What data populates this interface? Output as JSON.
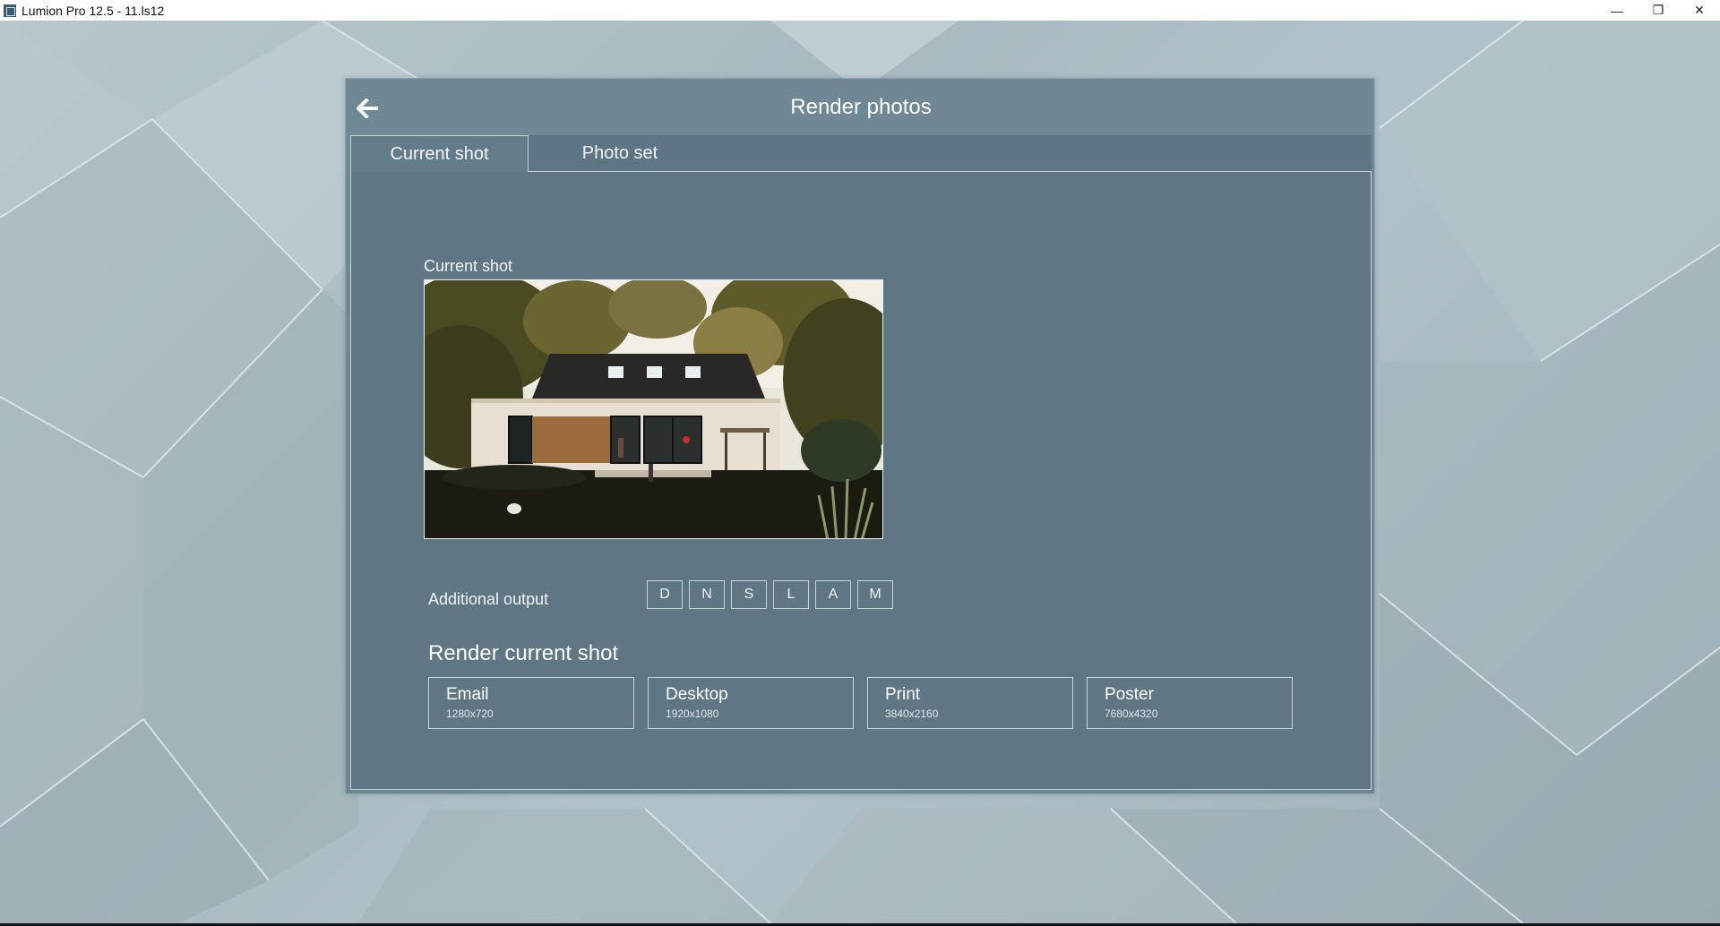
{
  "window": {
    "title": "Lumion Pro 12.5 - 11.ls12",
    "minimize_glyph": "—",
    "restore_glyph": "❐",
    "close_glyph": "✕"
  },
  "dialog": {
    "title": "Render photos",
    "back_icon": "arrow-left-icon",
    "tabs": [
      {
        "label": "Current shot",
        "active": true
      },
      {
        "label": "Photo set",
        "active": false
      }
    ],
    "current_shot_label": "Current shot",
    "additional_output": {
      "label": "Additional output",
      "buttons": [
        "D",
        "N",
        "S",
        "L",
        "A",
        "M"
      ]
    },
    "render_heading": "Render current shot",
    "presets": [
      {
        "name": "Email",
        "resolution": "1280x720"
      },
      {
        "name": "Desktop",
        "resolution": "1920x1080"
      },
      {
        "name": "Print",
        "resolution": "3840x2160"
      },
      {
        "name": "Poster",
        "resolution": "7680x4320"
      }
    ]
  },
  "colors": {
    "dialog_bg": "#6f8895",
    "panel_bg": "#5f7784",
    "tab_bar": "#5d7584",
    "border": "#c6d2d8"
  }
}
